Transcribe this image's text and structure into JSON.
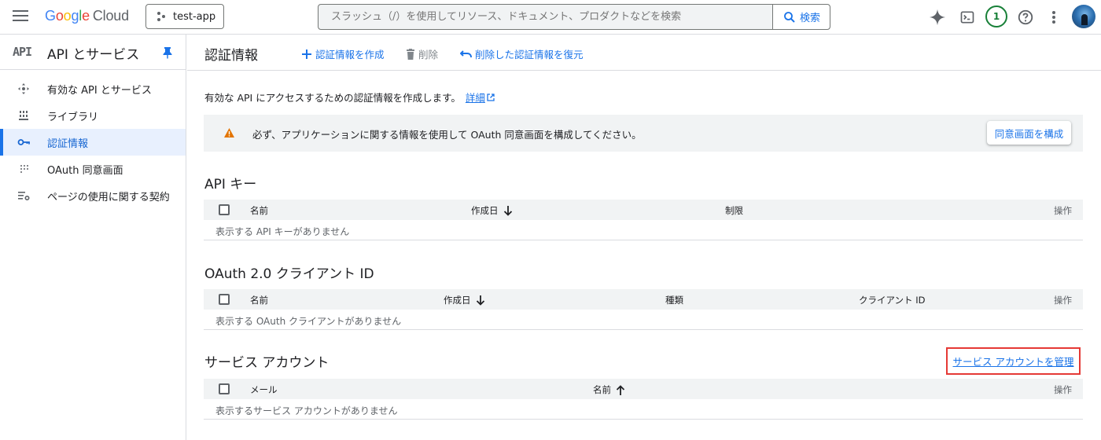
{
  "header": {
    "logo_google": [
      "G",
      "o",
      "o",
      "g",
      "l",
      "e"
    ],
    "logo_cloud": "Cloud",
    "project": "test-app",
    "search_placeholder": "スラッシュ（/）を使用してリソース、ドキュメント、プロダクトなどを検索",
    "search_button": "検索",
    "notification_count": "1"
  },
  "sidebar": {
    "mark": "API",
    "title": "API とサービス",
    "items": [
      {
        "label": "有効な API とサービス",
        "icon": "services-icon"
      },
      {
        "label": "ライブラリ",
        "icon": "library-icon"
      },
      {
        "label": "認証情報",
        "icon": "key-icon",
        "active": true
      },
      {
        "label": "OAuth 同意画面",
        "icon": "consent-icon"
      },
      {
        "label": "ページの使用に関する契約",
        "icon": "agreement-icon"
      }
    ]
  },
  "toolbar": {
    "title": "認証情報",
    "create": "認証情報を作成",
    "delete": "削除",
    "restore": "削除した認証情報を復元"
  },
  "content": {
    "intro": "有効な API にアクセスするための認証情報を作成します。",
    "intro_link": "詳細",
    "warning": "必ず、アプリケーションに関する情報を使用して OAuth 同意画面を構成してください。",
    "warning_button": "同意画面を構成",
    "api_keys": {
      "title": "API キー",
      "columns": [
        "名前",
        "作成日",
        "制限",
        "操作"
      ],
      "empty": "表示する API キーがありません"
    },
    "oauth": {
      "title": "OAuth 2.0 クライアント ID",
      "columns": [
        "名前",
        "作成日",
        "種類",
        "クライアント ID",
        "操作"
      ],
      "empty": "表示する OAuth クライアントがありません"
    },
    "service_accounts": {
      "title": "サービス アカウント",
      "manage_link": "サービス アカウントを管理",
      "columns": [
        "メール",
        "名前",
        "操作"
      ],
      "empty": "表示するサービス アカウントがありません"
    }
  },
  "colors": {
    "accent": "#1a73e8",
    "highlight_border": "#e53935",
    "warning": "#e37400"
  }
}
